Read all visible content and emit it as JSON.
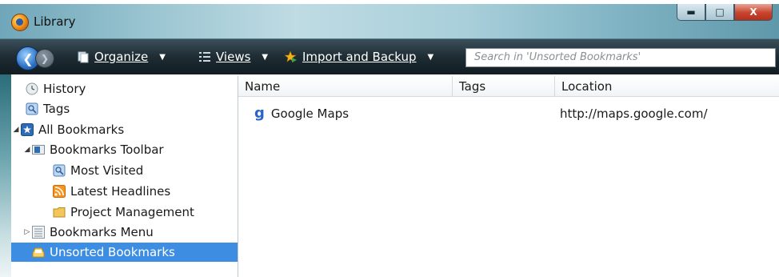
{
  "window": {
    "title": "Library"
  },
  "toolbar": {
    "organize": "Organize",
    "views": "Views",
    "import_backup": "Import and Backup",
    "search_placeholder": "Search in 'Unsorted Bookmarks'"
  },
  "sidebar": {
    "items": [
      {
        "label": "History",
        "icon": "clock-icon"
      },
      {
        "label": "Tags",
        "icon": "tag-icon"
      },
      {
        "label": "All Bookmarks",
        "icon": "star-folder-icon"
      },
      {
        "label": "Bookmarks Toolbar",
        "icon": "toolbar-icon"
      },
      {
        "label": "Most Visited",
        "icon": "smart-folder-icon"
      },
      {
        "label": "Latest Headlines",
        "icon": "rss-icon"
      },
      {
        "label": "Project Management",
        "icon": "folder-icon"
      },
      {
        "label": "Bookmarks Menu",
        "icon": "menu-icon"
      },
      {
        "label": "Unsorted Bookmarks",
        "icon": "unsorted-icon"
      }
    ]
  },
  "table": {
    "columns": [
      "Name",
      "Tags",
      "Location"
    ],
    "rows": [
      {
        "name": "Google Maps",
        "tags": "",
        "location": "http://maps.google.com/"
      }
    ]
  },
  "colors": {
    "selection": "#3d8ee2",
    "toolbar": "#1e2c34"
  }
}
